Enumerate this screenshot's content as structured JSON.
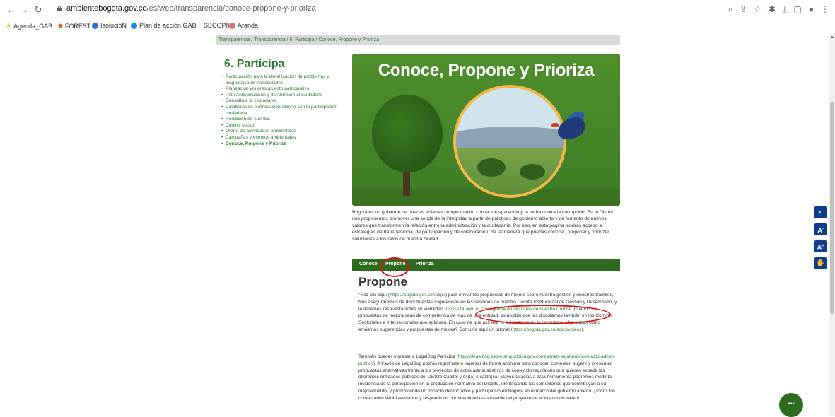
{
  "browser": {
    "url_domain": "ambientebogota.gov.co",
    "url_path": "/es/web/transparencia/conoce-propone-y-prioriza",
    "bookmarks": [
      "Agenda_GAB",
      "FOREST",
      "IsoluciöN",
      "Plan de acción GAB",
      "SECOPII",
      "Aranda"
    ]
  },
  "breadcrumb": "Transparencia / Transparencia / 6. Participa / Conoce, Propone y Prioriza",
  "sidebar": {
    "title": "6. Participa",
    "items": [
      "Participación para la identificación de problemas y diagnóstico de necesidades",
      "Planeación y/o presupuesto participativo",
      "Plan Anticorrupción y de Atención al ciudadano",
      "Consulta a la ciudadanía",
      "Colaboración e innovación abierta con la participación ciudadana",
      "Rendición de cuentas",
      "Control social",
      "Oferta de actividades ambientales",
      "Campañas y eventos ambientales",
      "Conoce, Propone y Prioriza"
    ]
  },
  "hero": {
    "title": "Conoce, Propone y Prioriza"
  },
  "intro": "Bogotá es un gobierno de puertas abiertas comprometido con la transparencia y la lucha contra la corrupción. En el Distrito nos proponemos promover una senda de la integridad a partir de prácticas de gobierno abierto y de fomento de nuevos valores que transformen la relación entre la administración y la ciudadanía. Por eso, en esta página tendrás acceso a estrategias de transparencia, de participación y de colaboración, de tal manera que puedas conocer, proponer y priorizar soluciones a los retos de nuestra ciudad.",
  "tabs": [
    "Conoce",
    "Propone",
    "Prioriza"
  ],
  "section": {
    "title": "Propone",
    "p1_a": "\"Haz clic aquí (",
    "p1_link1": "https://bogota.gov.co/adqs/",
    "p1_b": ") para enviarnos propuestas de mejora sobre nuestra gestión y nuestros trámites. Nos aseguraremos de discutir estas sugerencias en las sesiones de nuestro Comité Institucional de Gestión y Desempeño, y le daremos respuesta sobre su viabilidad.",
    "p1_link2": "Consulta aquí el cronograma de sesiones de nuestro Comité",
    "p1_c": ". Cuando tus propuestas de mejora sean de competencia de más de una entidad, es posible que las discutamos también en los Comités Sectoriales e Intersectoriales que apliquen. En caso de que así sea, te avisaremos en la respuesta. ¿No sabes cómo enviarnos sugerencias y propuestas de mejora? Consulta aquí un tutorial (",
    "p1_link3": "https://bogota.gov.co/adqs/videos",
    "p1_d": ").",
    "p2_a": "También puedes ingresar a LegalBog Participa (",
    "p2_link": "https://legalbog.secretariajuridica.gov.co/regimen-legal-publico#/acto-admin-publico",
    "p2_b": "). A través de LegalBog podrás registrarte o ingresar de forma anónima para conocer, comentar, sugerir y presentar propuestas alternativas frente a los proyectos de actos administrativos de contenido regulatorio que quieran expedir las diferentes entidades públicas del Distrito Capital y el (la) Alcalde(sa) Mayor. Gracias a esta herramienta podremos medir la incidencia de la participación en la producción normativa del Distrito, identificando los comentarios que contribuyan a su mejoramiento, y promoviendo un impacto democrático y participativo en Bogotá en el marco del gobierno abierto. ¡Todos tus comentarios serán revisados y respondidos por la entidad responsable del proyecto de acto administrativo!"
  },
  "colors": {
    "green": "#2e7d32",
    "tab_bar": "#2e6b1f",
    "annotation": "#e01010",
    "accessibility": "#0f3d8c"
  }
}
